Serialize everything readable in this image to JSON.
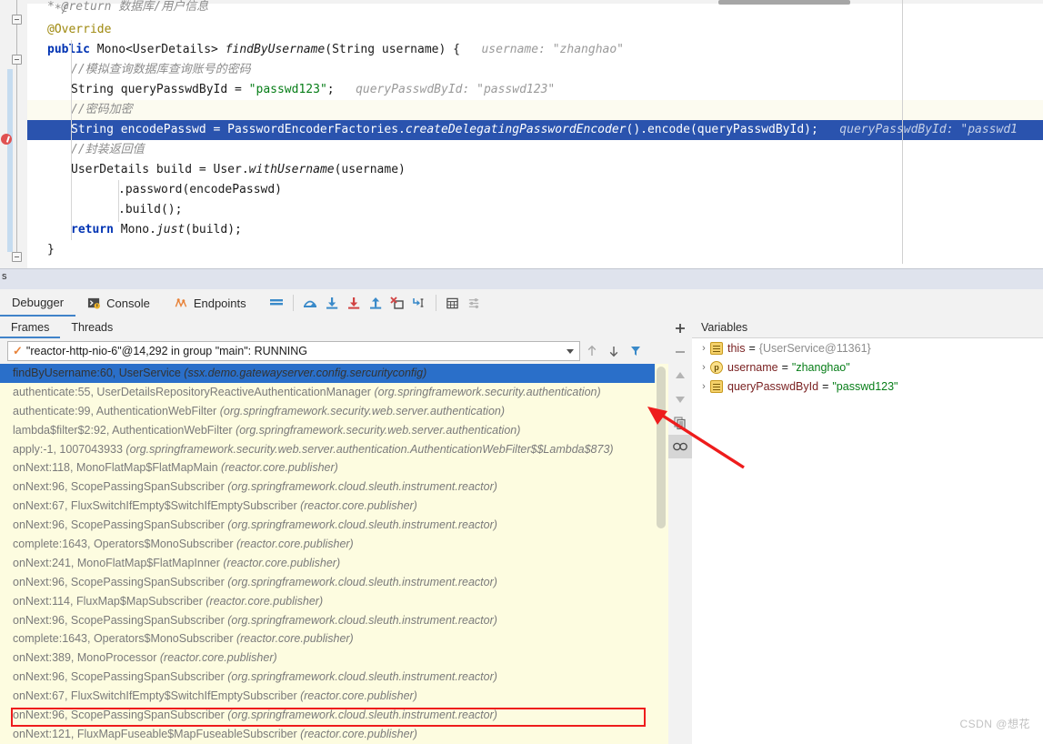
{
  "editor": {
    "cut_top_line": "* @return 数据库/用户信息",
    "lines": [
      {
        "indent": 1,
        "segments": [
          {
            "t": " */",
            "c": "cmt"
          }
        ]
      },
      {
        "indent": 1,
        "segments": [
          {
            "t": "@Override",
            "c": "anno"
          }
        ]
      },
      {
        "indent": 1,
        "segments": [
          {
            "t": "public ",
            "c": "kw"
          },
          {
            "t": "Mono<UserDetails> ",
            "c": "plain"
          },
          {
            "t": "findByUsername",
            "c": "meth"
          },
          {
            "t": "(String username) {",
            "c": "plain"
          },
          {
            "t": "   username: ",
            "c": "hint"
          },
          {
            "t": "\"zhanghao\"",
            "c": "hint"
          }
        ]
      },
      {
        "indent": 2,
        "segments": [
          {
            "t": "//模拟查询数据库查询账号的密码",
            "c": "cmt"
          }
        ]
      },
      {
        "indent": 2,
        "segments": [
          {
            "t": "String queryPasswdById = ",
            "c": "plain"
          },
          {
            "t": "\"passwd123\"",
            "c": "str"
          },
          {
            "t": ";",
            "c": "plain"
          },
          {
            "t": "   queryPasswdById: \"passwd123\"",
            "c": "hint"
          }
        ]
      },
      {
        "indent": 2,
        "highlight": "current",
        "segments": [
          {
            "t": "//密码加密",
            "c": "cmt"
          }
        ]
      },
      {
        "indent": 2,
        "highlight": "executing",
        "segments": [
          {
            "t": "String encodePasswd = PasswordEncoderFactories.",
            "c": "plain"
          },
          {
            "t": "createDelegatingPasswordEncoder",
            "c": "meth"
          },
          {
            "t": "().encode(queryPasswdById);",
            "c": "plain"
          },
          {
            "t": "   queryPasswdById: \"passwd1",
            "c": "hint"
          }
        ]
      },
      {
        "indent": 2,
        "segments": [
          {
            "t": "//封装返回值",
            "c": "cmt"
          }
        ]
      },
      {
        "indent": 2,
        "segments": [
          {
            "t": "UserDetails build = User.",
            "c": "plain"
          },
          {
            "t": "withUsername",
            "c": "meth"
          },
          {
            "t": "(username)",
            "c": "plain"
          }
        ]
      },
      {
        "indent": 4,
        "segments": [
          {
            "t": ".password(encodePasswd)",
            "c": "plain"
          }
        ]
      },
      {
        "indent": 4,
        "segments": [
          {
            "t": ".build();",
            "c": "plain"
          }
        ]
      },
      {
        "indent": 2,
        "segments": [
          {
            "t": "return ",
            "c": "kw"
          },
          {
            "t": "Mono.",
            "c": "plain"
          },
          {
            "t": "just",
            "c": "meth"
          },
          {
            "t": "(build);",
            "c": "plain"
          }
        ]
      },
      {
        "indent": 1,
        "segments": [
          {
            "t": "}",
            "c": "plain"
          }
        ]
      }
    ]
  },
  "status_strip": {
    "text": "s"
  },
  "toolbar": {
    "tabs": [
      {
        "label": "Debugger",
        "icon": "debugger-icon",
        "active": true
      },
      {
        "label": "Console",
        "icon": "console-icon",
        "active": false
      },
      {
        "label": "Endpoints",
        "icon": "endpoints-icon",
        "active": false
      }
    ],
    "actions": [
      {
        "name": "show-execution-point-icon",
        "title": "Show Execution Point"
      },
      {
        "name": "step-over-icon",
        "title": "Step Over"
      },
      {
        "name": "step-into-icon",
        "title": "Step Into"
      },
      {
        "name": "force-step-into-icon",
        "title": "Force Step Into"
      },
      {
        "name": "step-out-icon",
        "title": "Step Out"
      },
      {
        "name": "drop-frame-icon",
        "title": "Drop Frame"
      },
      {
        "name": "run-to-cursor-icon",
        "title": "Run to Cursor"
      },
      {
        "name": "evaluate-expression-icon",
        "title": "Evaluate Expression"
      },
      {
        "name": "settings-icon",
        "title": "Layout Settings"
      }
    ]
  },
  "frames_panel": {
    "tabs": [
      {
        "label": "Frames",
        "active": true
      },
      {
        "label": "Threads",
        "active": false
      }
    ],
    "thread_selector": {
      "value": "\"reactor-http-nio-6\"@14,292 in group \"main\": RUNNING",
      "state_icon": "running-check-icon"
    },
    "nav_buttons": [
      {
        "name": "move-up-icon",
        "label": "↑"
      },
      {
        "name": "move-down-icon",
        "label": "↓"
      },
      {
        "name": "filter-icon",
        "label": "▼"
      }
    ],
    "frames": [
      {
        "method": "findByUsername:60, UserService",
        "pkg": "(ssx.demo.gatewayserver.config.sercurityconfig)",
        "selected": true,
        "app": true
      },
      {
        "method": "authenticate:55, UserDetailsRepositoryReactiveAuthenticationManager",
        "pkg": "(org.springframework.security.authentication)",
        "highlighted": true
      },
      {
        "method": "authenticate:99, AuthenticationWebFilter",
        "pkg": "(org.springframework.security.web.server.authentication)"
      },
      {
        "method": "lambda$filter$2:92, AuthenticationWebFilter",
        "pkg": "(org.springframework.security.web.server.authentication)"
      },
      {
        "method": "apply:-1, 1007043933",
        "pkg": "(org.springframework.security.web.server.authentication.AuthenticationWebFilter$$Lambda$873)"
      },
      {
        "method": "onNext:118, MonoFlatMap$FlatMapMain",
        "pkg": "(reactor.core.publisher)"
      },
      {
        "method": "onNext:96, ScopePassingSpanSubscriber",
        "pkg": "(org.springframework.cloud.sleuth.instrument.reactor)"
      },
      {
        "method": "onNext:67, FluxSwitchIfEmpty$SwitchIfEmptySubscriber",
        "pkg": "(reactor.core.publisher)"
      },
      {
        "method": "onNext:96, ScopePassingSpanSubscriber",
        "pkg": "(org.springframework.cloud.sleuth.instrument.reactor)"
      },
      {
        "method": "complete:1643, Operators$MonoSubscriber",
        "pkg": "(reactor.core.publisher)"
      },
      {
        "method": "onNext:241, MonoFlatMap$FlatMapInner",
        "pkg": "(reactor.core.publisher)"
      },
      {
        "method": "onNext:96, ScopePassingSpanSubscriber",
        "pkg": "(org.springframework.cloud.sleuth.instrument.reactor)"
      },
      {
        "method": "onNext:114, FluxMap$MapSubscriber",
        "pkg": "(reactor.core.publisher)"
      },
      {
        "method": "onNext:96, ScopePassingSpanSubscriber",
        "pkg": "(org.springframework.cloud.sleuth.instrument.reactor)"
      },
      {
        "method": "complete:1643, Operators$MonoSubscriber",
        "pkg": "(reactor.core.publisher)"
      },
      {
        "method": "onNext:389, MonoProcessor",
        "pkg": "(reactor.core.publisher)"
      },
      {
        "method": "onNext:96, ScopePassingSpanSubscriber",
        "pkg": "(org.springframework.cloud.sleuth.instrument.reactor)"
      },
      {
        "method": "onNext:67, FluxSwitchIfEmpty$SwitchIfEmptySubscriber",
        "pkg": "(reactor.core.publisher)"
      },
      {
        "method": "onNext:96, ScopePassingSpanSubscriber",
        "pkg": "(org.springframework.cloud.sleuth.instrument.reactor)"
      },
      {
        "method": "onNext:121, FluxMapFuseable$MapFuseableSubscriber",
        "pkg": "(reactor.core.publisher)"
      }
    ]
  },
  "side_tools": [
    {
      "name": "add-watch-button",
      "glyph": "+"
    },
    {
      "name": "remove-watch-button",
      "glyph": "−"
    },
    {
      "name": "move-watch-up-button",
      "glyph": "▲"
    },
    {
      "name": "move-watch-down-button",
      "glyph": "▼"
    },
    {
      "name": "copy-stack-button",
      "glyph": "copy-icon"
    },
    {
      "name": "watches-toggle-button",
      "glyph": "glasses-icon",
      "pressed": true
    }
  ],
  "variables_panel": {
    "title": "Variables",
    "rows": [
      {
        "icon": "field-icon",
        "name": "this",
        "value": "{UserService@11361}",
        "value_type": "object"
      },
      {
        "icon": "param-icon",
        "name": "username",
        "value": "\"zhanghao\"",
        "value_type": "string"
      },
      {
        "icon": "field-icon",
        "name": "queryPasswdById",
        "value": "\"passwd123\"",
        "value_type": "string"
      }
    ]
  },
  "annotation": {
    "arrow_color": "#ee1c1c",
    "box_color": "#ee1c1c"
  },
  "watermark": {
    "text": "CSDN @想花"
  },
  "colors": {
    "accent": "#4083c9",
    "selection": "#2a6fc9",
    "exec_line": "#2a53ae",
    "frames_bg": "#fdfce0",
    "annotation_red": "#ee1c1c"
  }
}
